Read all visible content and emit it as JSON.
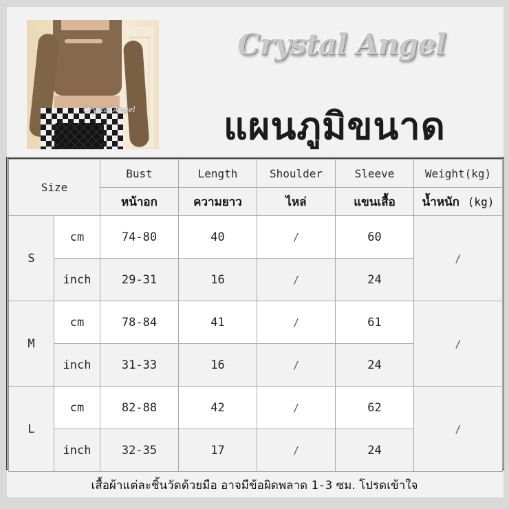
{
  "brand": {
    "name": "Crystal Angel",
    "sparkle_icon": "sparkle-icon"
  },
  "title": "แผนภูมิขนาด",
  "photo": {
    "alt": "model wearing brown cutout cardigan crop top with checkered pants and black quilted bag",
    "watermark": "Crystal Angel"
  },
  "table": {
    "size_header": "Size",
    "columns": [
      {
        "en": "Bust",
        "th": "หน้าอก"
      },
      {
        "en": "Length",
        "th": "ความยาว"
      },
      {
        "en": "Shoulder",
        "th": "ไหล่"
      },
      {
        "en": "Sleeve",
        "th": "แขนเสื้อ"
      },
      {
        "en": "Weight(kg)",
        "th": "น้ำหนัก",
        "th_suffix": "(kg)"
      }
    ],
    "sizes": [
      {
        "size": "S",
        "weight": "/",
        "rows": [
          {
            "unit": "cm",
            "bust": "74-80",
            "length": "40",
            "shoulder": "/",
            "sleeve": "60"
          },
          {
            "unit": "inch",
            "bust": "29-31",
            "length": "16",
            "shoulder": "/",
            "sleeve": "24"
          }
        ]
      },
      {
        "size": "M",
        "weight": "/",
        "rows": [
          {
            "unit": "cm",
            "bust": "78-84",
            "length": "41",
            "shoulder": "/",
            "sleeve": "61"
          },
          {
            "unit": "inch",
            "bust": "31-33",
            "length": "16",
            "shoulder": "/",
            "sleeve": "24"
          }
        ]
      },
      {
        "size": "L",
        "weight": "/",
        "rows": [
          {
            "unit": "cm",
            "bust": "82-88",
            "length": "42",
            "shoulder": "/",
            "sleeve": "62"
          },
          {
            "unit": "inch",
            "bust": "32-35",
            "length": "17",
            "shoulder": "/",
            "sleeve": "24"
          }
        ]
      }
    ]
  },
  "note": {
    "part1": "เสื้อผ้าแต่ละชิ้นวัดด้วยมือ อาจมีข้อผิดพลาด",
    "range": "1-3",
    "part2": "ซม. โปรดเข้าใจ"
  }
}
